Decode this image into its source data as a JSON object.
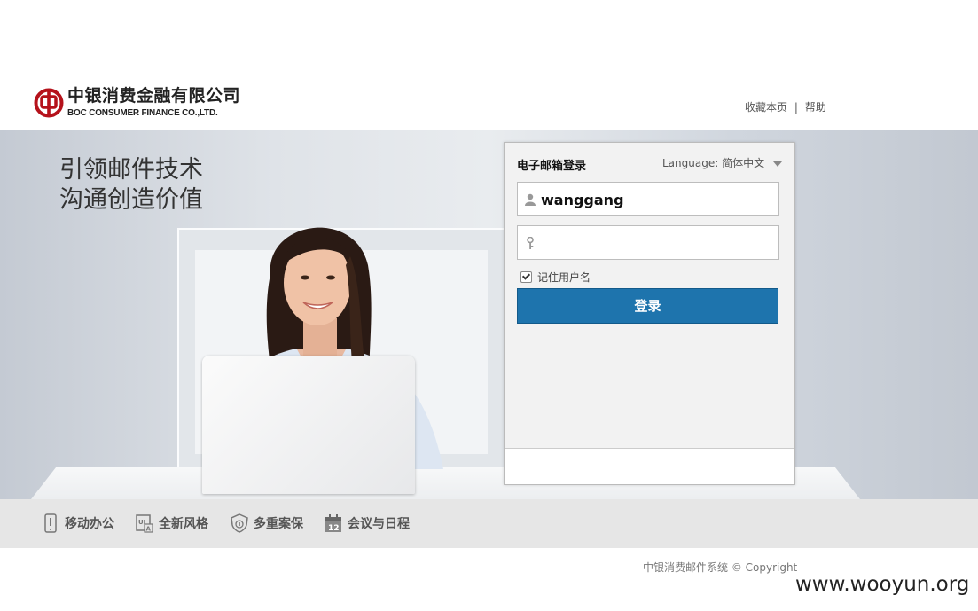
{
  "header": {
    "logo_cn": "中银消费金融有限公司",
    "logo_en": "BOC CONSUMER FINANCE CO.,LTD.",
    "links": {
      "bookmark": "收藏本页",
      "separator": "|",
      "help": "帮助"
    }
  },
  "hero": {
    "slogan_line1": "引领邮件技术",
    "slogan_line2": "沟通创造价值"
  },
  "login": {
    "title": "电子邮箱登录",
    "language_label": "Language:",
    "language_value": "简体中文",
    "username_value": "wanggang",
    "password_value": "",
    "remember_label": "记住用户名",
    "remember_checked": true,
    "submit_label": "登录"
  },
  "features": [
    {
      "label": "移动办公",
      "icon": "mobile-icon"
    },
    {
      "label": "全新风格",
      "icon": "ui-style-icon"
    },
    {
      "label": "多重案保",
      "icon": "shield-icon"
    },
    {
      "label": "会议与日程",
      "icon": "calendar-icon",
      "icon_text": "12"
    }
  ],
  "footer": {
    "copyright": "中银消费邮件系统 © Copyright",
    "watermark": "www.wooyun.org"
  },
  "colors": {
    "button": "#1e74ad",
    "brand_red": "#b5121b",
    "feature_bar": "#e6e6e6"
  }
}
